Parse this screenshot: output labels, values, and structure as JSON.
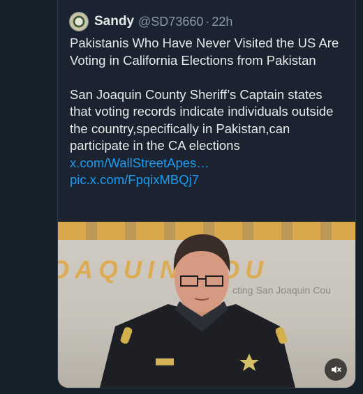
{
  "tweet": {
    "display_name": "Sandy",
    "handle": "@SD73660",
    "separator": "·",
    "time": "22h",
    "text_headline": "Pakistanis Who Have Never Visited the US Are Voting in California Elections from Pakistan",
    "text_body": "San Joaquin County Sheriff’s Captain states that voting records indicate individuals outside the country,specifically in Pakistan,can participate in the CA elections ",
    "link_text": "x.com/WallStreetApes…",
    "pic_link_text": "pic.x.com/FpqixMBQj7"
  },
  "media": {
    "banner_text": "OAQUIN COU",
    "sign_text": "cting San Joaquin Cou",
    "mute_icon": "speaker-muted-icon"
  },
  "colors": {
    "background": "#15202b",
    "link": "#1d9bf0",
    "text": "#e7e9ea",
    "secondary_text": "#8b98a5"
  }
}
